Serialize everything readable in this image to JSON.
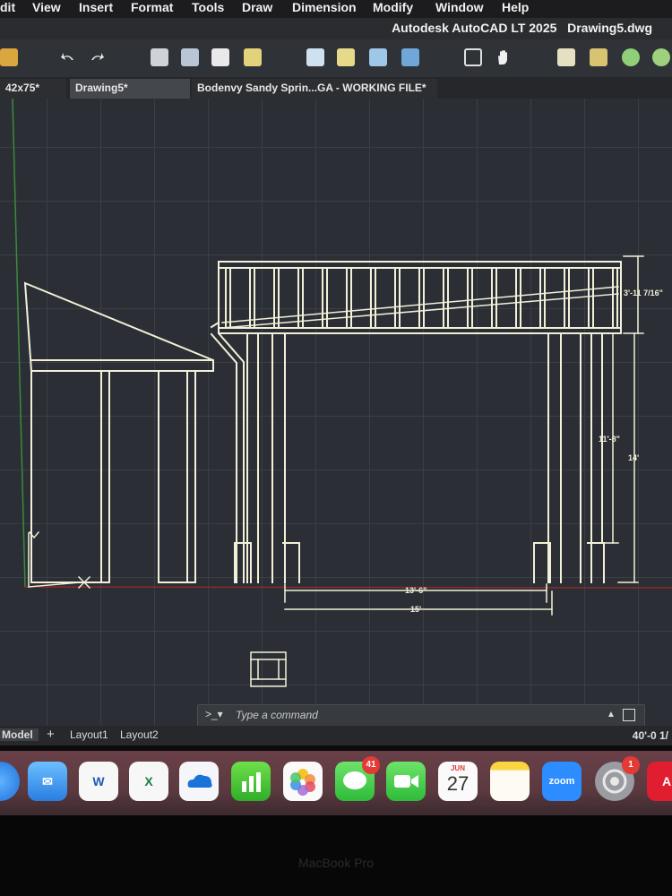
{
  "menu": [
    "dit",
    "View",
    "Insert",
    "Format",
    "Tools",
    "Draw",
    "Dimension",
    "Modify",
    "Window",
    "Help"
  ],
  "app": {
    "name": "Autodesk AutoCAD LT 2025",
    "file": "Drawing5.dwg"
  },
  "tabs": [
    "42x75*",
    "Drawing5*",
    "Bodenvy Sandy Sprin...GA - WORKING FILE*"
  ],
  "dimensions": {
    "top_height": "3'-11 7/16\"",
    "post_height": "11'-8\"",
    "total_height": "14'",
    "inner_width": "13'-6\"",
    "outer_width": "15'"
  },
  "command": {
    "placeholder": "Type a command"
  },
  "layout_tabs": {
    "model": "Model",
    "add": "+",
    "layout1": "Layout1",
    "layout2": "Layout2"
  },
  "status": {
    "scale": "40'-0 1/"
  },
  "dock": {
    "apps": [
      "safari-icon",
      "mail-icon",
      "word-icon",
      "excel-icon",
      "onedrive-icon",
      "numbers-icon",
      "photos-icon",
      "messages-icon",
      "facetime-icon",
      "calendar-icon",
      "notes-icon",
      "zoom-icon",
      "system-settings-icon",
      "acrobat-icon"
    ],
    "messages_badge": "41",
    "settings_badge": "1",
    "calendar_month": "JUN",
    "calendar_day": "27",
    "zoom_label": "zoom",
    "word_letter": "W",
    "excel_letter": "X"
  },
  "bezel": "MacBook Pro",
  "colors": {
    "canvas": "#2b2f35",
    "lines": "#f2f0d8",
    "red_axis": "#8b2a2a",
    "green_axis": "#3a8a3a"
  }
}
